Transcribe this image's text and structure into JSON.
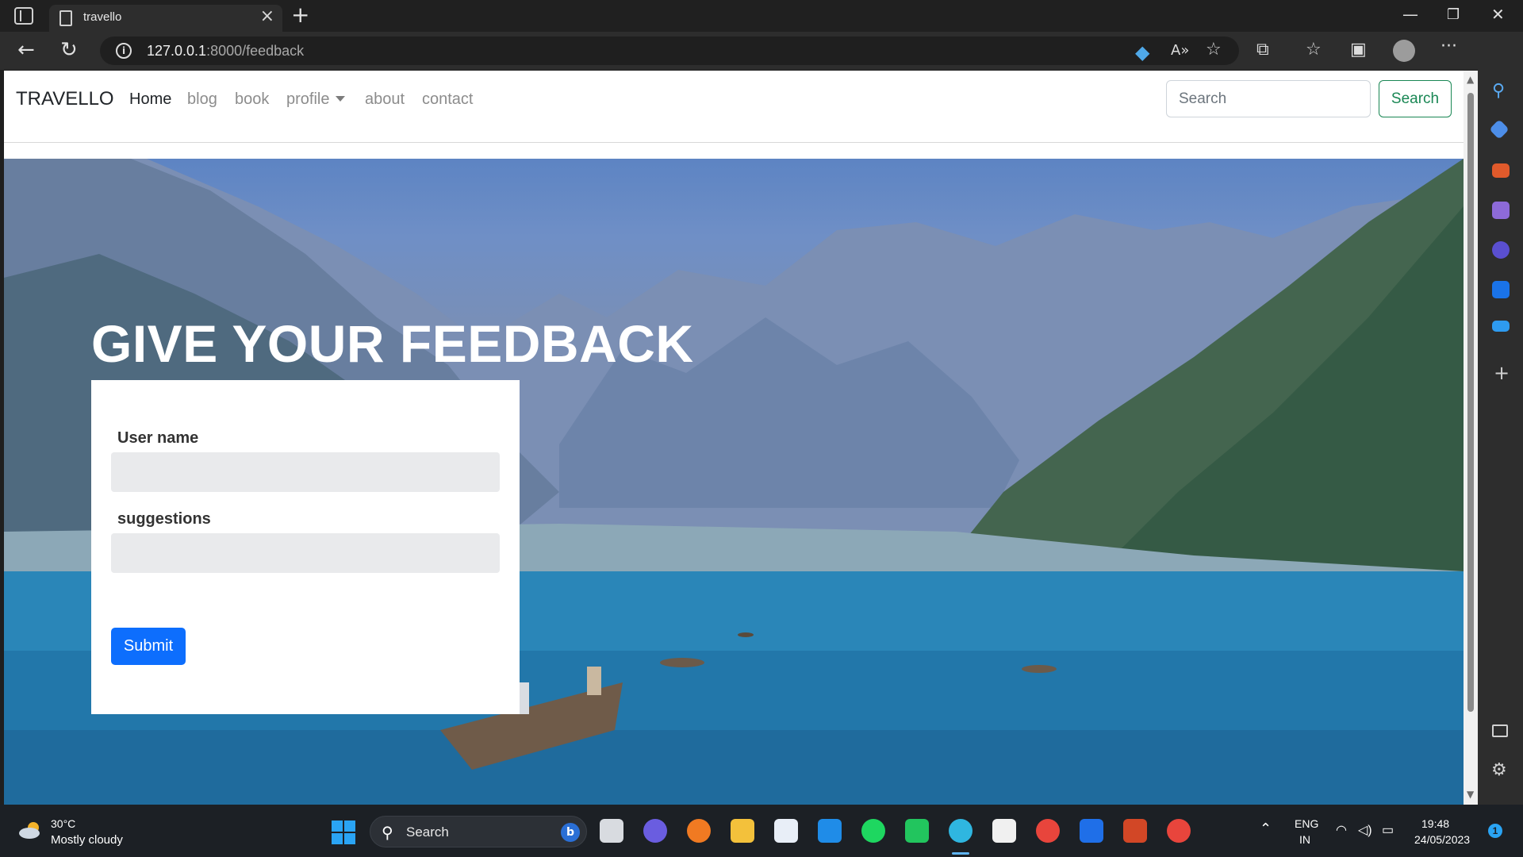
{
  "browser": {
    "tab_title": "travello",
    "url_host": "127.0.0.1",
    "url_rest": ":8000/feedback"
  },
  "navbar": {
    "brand": "TRAVELLO",
    "links": [
      "Home",
      "blog",
      "book",
      "profile",
      "about",
      "contact"
    ],
    "search_placeholder": "Search",
    "search_button": "Search"
  },
  "hero": {
    "heading": "GIVE YOUR FEEDBACK"
  },
  "form": {
    "username_label": "User name",
    "suggestions_label": "suggestions",
    "submit_label": "Submit"
  },
  "taskbar": {
    "weather_temp": "30°C",
    "weather_desc": "Mostly cloudy",
    "search_label": "Search",
    "language": "ENG",
    "region": "IN",
    "time": "19:48",
    "date": "24/05/2023",
    "notification_count": "1"
  },
  "colors": {
    "primary": "#0d6efd",
    "success": "#198754",
    "browser_chrome": "#2d2d2d"
  }
}
